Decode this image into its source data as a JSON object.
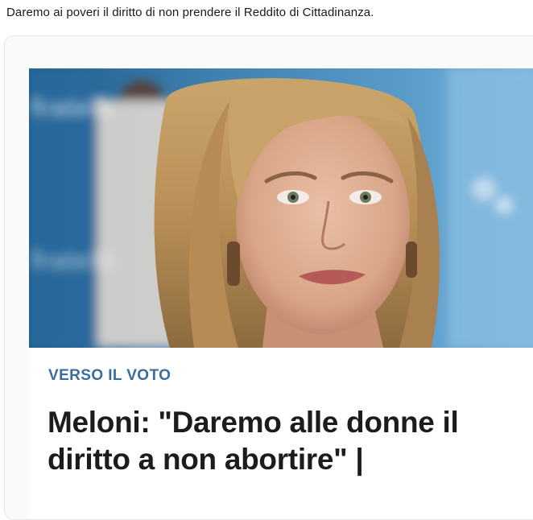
{
  "post": {
    "text": "Daremo ai poveri il diritto di non prendere il Reddito di Cittadinanza."
  },
  "link_card": {
    "category": "VERSO IL VOTO",
    "headline_line1": "Meloni: \"Daremo alle donne il",
    "headline_line2": "diritto a non abortire\" |"
  },
  "colors": {
    "category_text": "#3a6d9e",
    "headline_text": "#1c1c1c",
    "photo_background": "#2f6fa0"
  }
}
